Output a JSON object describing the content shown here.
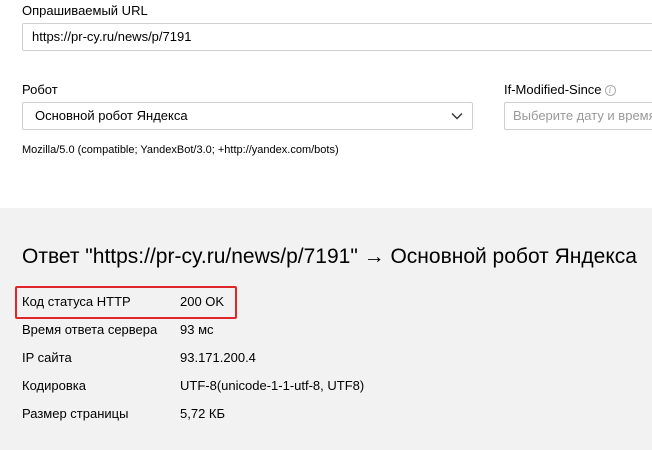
{
  "form": {
    "url_label": "Опрашиваемый URL",
    "url_value": "https://pr-cy.ru/news/p/7191",
    "robot_label": "Робот",
    "robot_selected": "Основной робот Яндекса",
    "ims_label": "If-Modified-Since",
    "ims_info_glyph": "i",
    "ims_placeholder": "Выберите дату и время",
    "user_agent": "Mozilla/5.0 (compatible; YandexBot/3.0; +http://yandex.com/bots)"
  },
  "result": {
    "title": "Ответ \"https://pr-cy.ru/news/p/7191\" → Основной робот Яндекса",
    "rows": [
      {
        "key": "Код статуса HTTP",
        "value": "200 OK"
      },
      {
        "key": "Время ответа сервера",
        "value": "93 мс"
      },
      {
        "key": "IP сайта",
        "value": "93.171.200.4"
      },
      {
        "key": "Кодировка",
        "value": "UTF-8(unicode-1-1-utf-8, UTF8)"
      },
      {
        "key": "Размер страницы",
        "value": "5,72 КБ"
      }
    ],
    "highlight_color": "#e0262a"
  },
  "colors": {
    "result_background": "#f2f2f2",
    "border": "#d0d0d0"
  },
  "icons": {
    "select_arrow": "chevron-down-icon",
    "info": "info-icon"
  }
}
